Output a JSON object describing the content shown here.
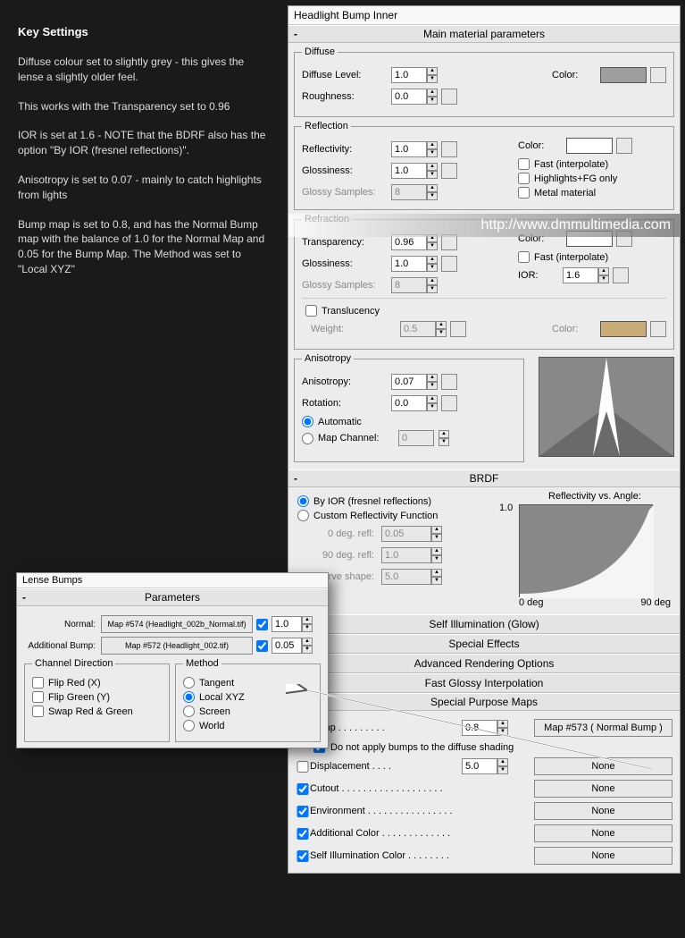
{
  "left": {
    "title": "Key Settings",
    "p1": "Diffuse colour set to slightly grey - this gives the lense a slightly older feel.",
    "p2": "This works with the Transparency set to 0.96",
    "p3": "IOR is set at 1.6 - NOTE that the BDRF also has the option \"By IOR (fresnel reflections)\".",
    "p4": "Anisotropy is set to 0.07 - mainly to catch highlights from lights",
    "p5": "Bump map is set to 0.8, and has the Normal Bump map with the balance of 1.0 for the Normal Map and 0.05 for the Bump Map. The Method was set to \"Local XYZ\""
  },
  "main": {
    "title": "Headlight Bump Inner",
    "rollout1": "Main material parameters",
    "diffuse": {
      "legend": "Diffuse",
      "level_label": "Diffuse Level:",
      "level": "1.0",
      "roughness_label": "Roughness:",
      "roughness": "0.0",
      "color_label": "Color:",
      "color": "#9e9e9e"
    },
    "reflection": {
      "legend": "Reflection",
      "refl_label": "Reflectivity:",
      "refl": "1.0",
      "gloss_label": "Glossiness:",
      "gloss": "1.0",
      "samples_label": "Glossy Samples:",
      "samples": "8",
      "color_label": "Color:",
      "color": "#ffffff",
      "fast": "Fast (interpolate)",
      "highlights": "Highlights+FG only",
      "metal": "Metal material"
    },
    "refraction": {
      "legend": "Refraction",
      "trans_label": "Transparency:",
      "trans": "0.96",
      "gloss_label": "Glossiness:",
      "gloss": "1.0",
      "samples_label": "Glossy Samples:",
      "samples": "8",
      "color_label": "Color:",
      "color": "#ffffff",
      "fast": "Fast (interpolate)",
      "ior_label": "IOR:",
      "ior": "1.6",
      "translucency": "Translucency",
      "weight_label": "Weight:",
      "weight": "0.5",
      "trans_color": "#c9ab77"
    },
    "aniso": {
      "legend": "Anisotropy",
      "aniso_label": "Anisotropy:",
      "aniso": "0.07",
      "rot_label": "Rotation:",
      "rot": "0.0",
      "auto": "Automatic",
      "map_channel": "Map Channel:",
      "channel": "0"
    },
    "brdf": {
      "rollout": "BRDF",
      "by_ior": "By IOR (fresnel reflections)",
      "custom": "Custom Reflectivity Function",
      "deg0_label": "0 deg. refl:",
      "deg0": "0.05",
      "deg90_label": "90 deg. refl:",
      "deg90": "1.0",
      "curve_label": "Curve shape:",
      "curve": "5.0",
      "graph_title": "Reflectivity vs. Angle:",
      "axis_1": "1.0",
      "axis_0deg": "0 deg",
      "axis_90deg": "90 deg"
    },
    "rollouts": {
      "self_illum": "Self Illumination (Glow)",
      "special_fx": "Special Effects",
      "adv_render": "Advanced Rendering Options",
      "fast_glossy": "Fast Glossy Interpolation",
      "spm": "Special Purpose Maps"
    },
    "spm": {
      "bump_label": "Bump  . . . . . . . . .",
      "bump_val": "0.8",
      "bump_map": "Map #573  ( Normal Bump )",
      "bump_diffuse": "Do not apply bumps to the diffuse shading",
      "disp_label": "Displacement . . . .",
      "disp_val": "5.0",
      "cutout_label": "Cutout . . . . . . . . . . . . . . . . . . .",
      "env_label": "Environment . . . . . . . . . . . . . . . .",
      "addcol_label": "Additional Color  . . . . . . . . . . . . .",
      "selfillum_label": "Self Illumination Color  . . . . . . . .",
      "none": "None"
    }
  },
  "lense": {
    "title": "Lense Bumps",
    "rollout": "Parameters",
    "normal_label": "Normal:",
    "normal_map": "Map #574 (Headlight_002b_Normal.tif)",
    "normal_val": "1.0",
    "addbump_label": "Additional Bump:",
    "addbump_map": "Map #572 (Headlight_002.tif)",
    "addbump_val": "0.05",
    "channel_legend": "Channel Direction",
    "flip_red": "Flip Red (X)",
    "flip_green": "Flip Green (Y)",
    "swap": "Swap Red & Green",
    "method_legend": "Method",
    "tangent": "Tangent",
    "local_xyz": "Local XYZ",
    "screen": "Screen",
    "world": "World"
  },
  "watermark": "http://www.dmmultimedia.com"
}
